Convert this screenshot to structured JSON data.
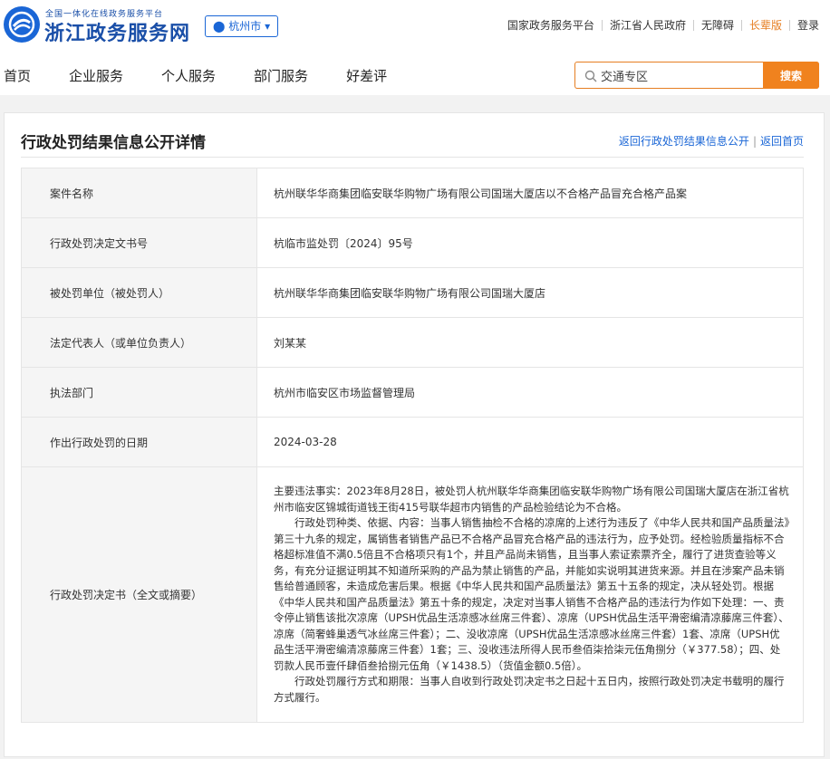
{
  "header": {
    "logo_sub": "全国一体化在线政务服务平台",
    "logo_title": "浙江政务服务网",
    "city": "杭州市",
    "links": [
      "国家政务服务平台",
      "浙江省人民政府",
      "无障碍",
      "长辈版",
      "登录"
    ]
  },
  "nav": [
    "首页",
    "企业服务",
    "个人服务",
    "部门服务",
    "好差评"
  ],
  "search": {
    "value": "交通专区",
    "button": "搜索"
  },
  "page": {
    "title": "行政处罚结果信息公开详情",
    "back_list": "返回行政处罚结果信息公开",
    "back_home": "返回首页"
  },
  "rows": [
    {
      "k": "案件名称",
      "v": "杭州联华华商集团临安联华购物广场有限公司国瑞大厦店以不合格产品冒充合格产品案"
    },
    {
      "k": "行政处罚决定文书号",
      "v": "杭临市监处罚〔2024〕95号"
    },
    {
      "k": "被处罚单位（被处罚人）",
      "v": "杭州联华华商集团临安联华购物广场有限公司国瑞大厦店"
    },
    {
      "k": "法定代表人（或单位负责人）",
      "v": "刘某某"
    },
    {
      "k": "执法部门",
      "v": "杭州市临安区市场监督管理局"
    },
    {
      "k": "作出行政处罚的日期",
      "v": "2024-03-28"
    }
  ],
  "decision": {
    "k": "行政处罚决定书（全文或摘要）",
    "p1": "主要违法事实：2023年8月28日，被处罚人杭州联华华商集团临安联华购物广场有限公司国瑞大厦店在浙江省杭州市临安区锦城街道钱王街415号联华超市内销售的产品检验结论为不合格。",
    "p2": "行政处罚种类、依据、内容：当事人销售抽检不合格的凉席的上述行为违反了《中华人民共和国产品质量法》第三十九条的规定，属销售者销售产品已不合格产品冒充合格产品的违法行为，应予处罚。经检验质量指标不合格超标准值不满0.5倍且不合格项只有1个，并且产品尚未销售，且当事人索证索票齐全，履行了进货查验等义务，有充分证据证明其不知道所采购的产品为禁止销售的产品，并能如实说明其进货来源。并且在涉案产品未销售给普通顾客，未造成危害后果。根据《中华人民共和国产品质量法》第五十五条的规定，决从轻处罚。根据《中华人民共和国产品质量法》第五十条的规定，决定对当事人销售不合格产品的违法行为作如下处理：一、责令停止销售该批次凉席（UPSH优品生活凉感冰丝席三件套）、凉席（UPSH优品生活平滑密编清凉藤席三件套）、凉席（简奢蜂巢透气冰丝席三件套）；二、没收凉席（UPSH优品生活凉感冰丝席三件套）1套、凉席（UPSH优品生活平滑密编清凉藤席三件套）1套；三、没收违法所得人民币叁佰柒拾柒元伍角捌分（￥377.58）；四、处罚款人民币壹仟肆佰叁拾捌元伍角（￥1438.5）（货值金额0.5倍）。",
    "p3": "行政处罚履行方式和期限：当事人自收到行政处罚决定书之日起十五日内，按照行政处罚决定书载明的履行方式履行。"
  }
}
